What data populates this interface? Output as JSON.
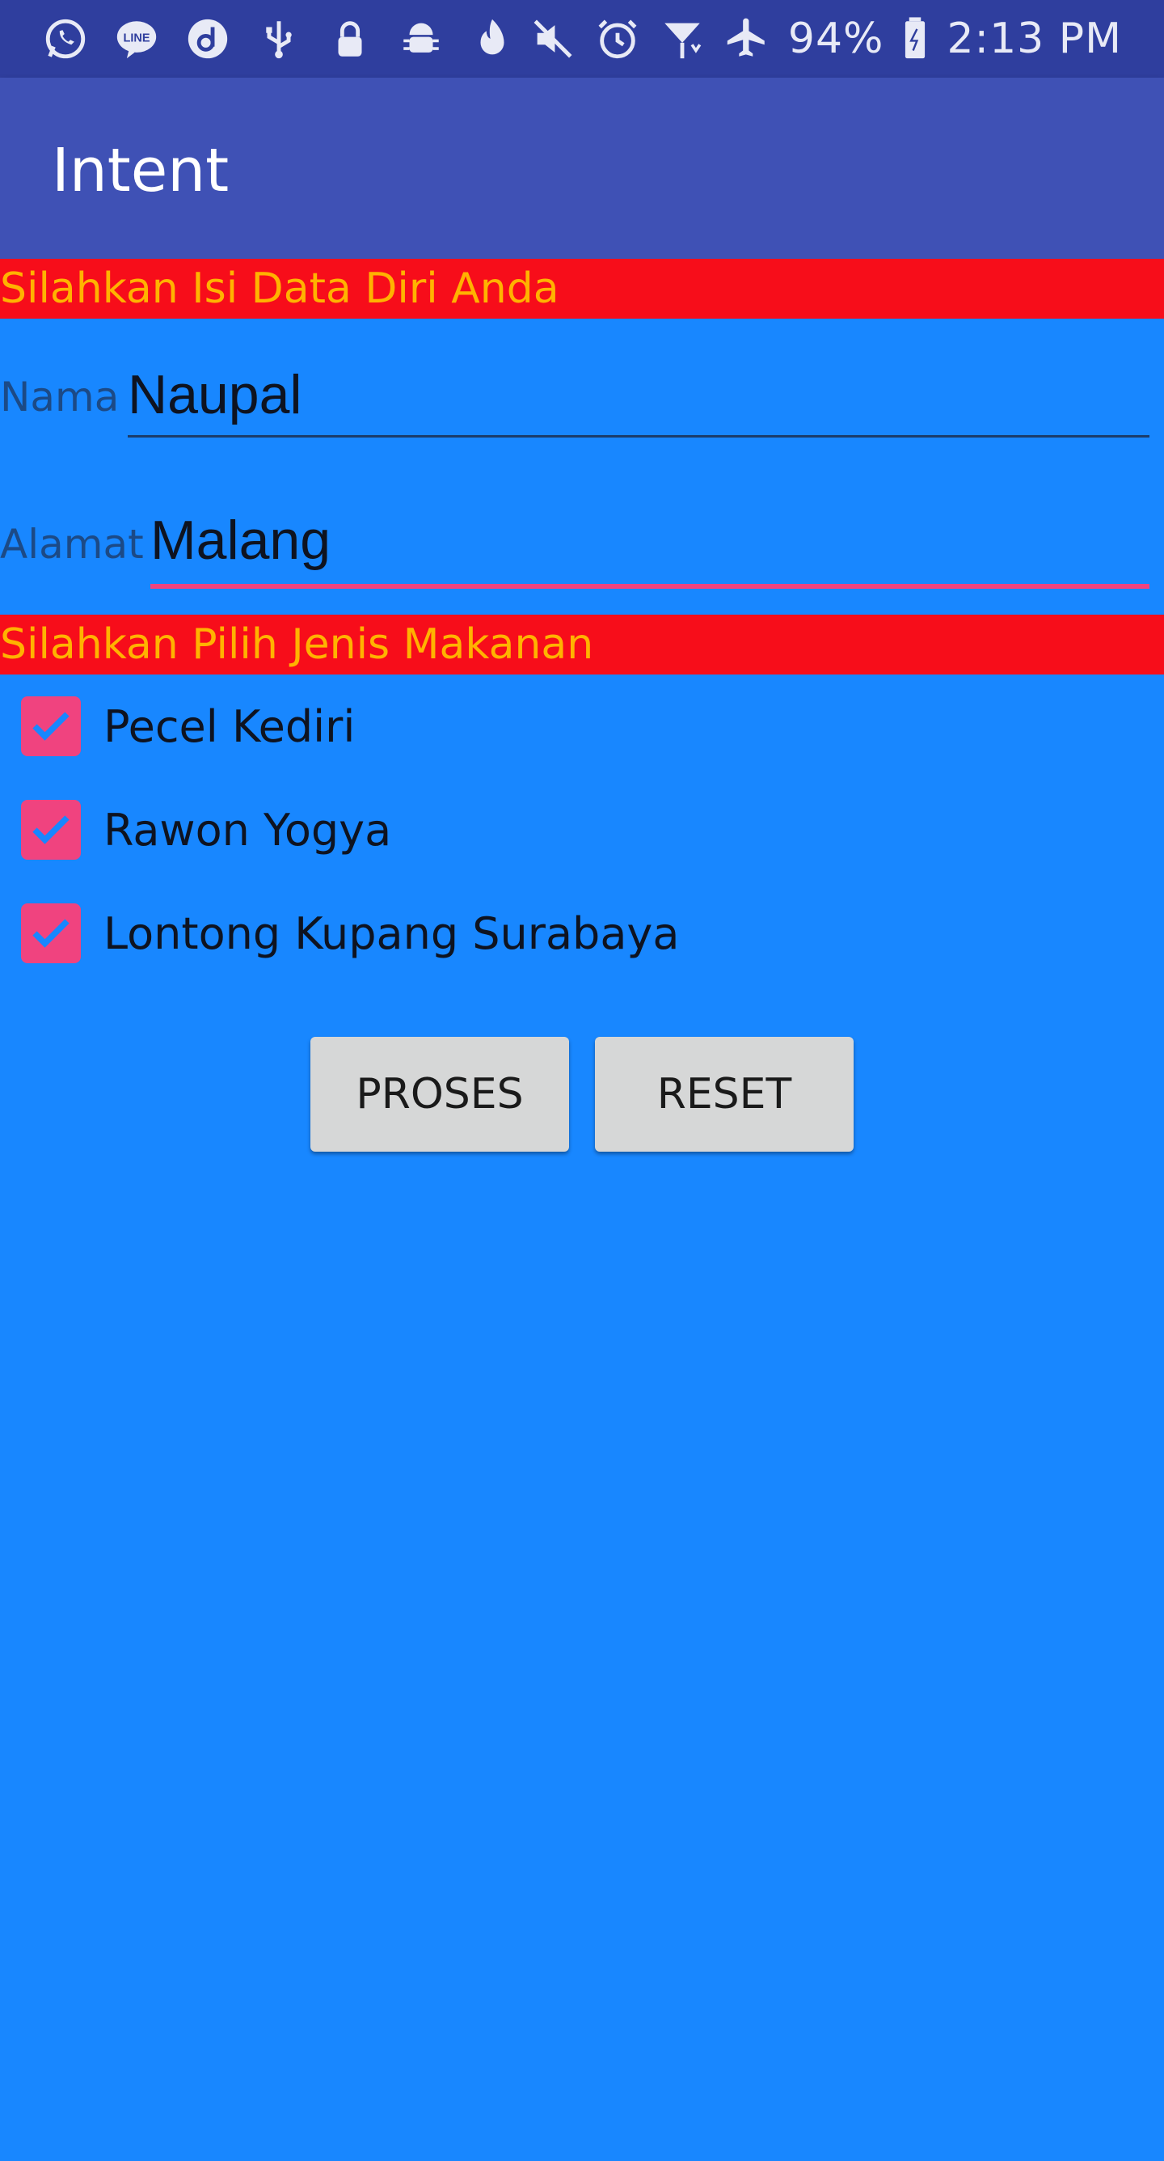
{
  "status_bar": {
    "left_icons": [
      "whatsapp-icon",
      "line-icon",
      "dana-icon",
      "usb-icon",
      "lock-icon",
      "android-debug-icon",
      "tinder-icon"
    ],
    "right_icons": [
      "mute-icon",
      "alarm-icon",
      "signal-icon",
      "airplane-icon",
      "battery-icon"
    ],
    "battery": "94%",
    "time": "2:13 PM"
  },
  "app_bar": {
    "title": "Intent"
  },
  "personal_section": {
    "header": "Silahkan Isi Data Diri Anda"
  },
  "form": {
    "nama": {
      "label": "Nama",
      "value": "Naupal"
    },
    "alamat": {
      "label": "Alamat",
      "value": "Malang"
    }
  },
  "food_section": {
    "header": "Silahkan Pilih Jenis Makanan"
  },
  "foods": [
    {
      "label": "Pecel Kediri",
      "checked": true
    },
    {
      "label": "Rawon Yogya",
      "checked": true
    },
    {
      "label": "Lontong Kupang Surabaya",
      "checked": true
    }
  ],
  "buttons": {
    "proses": "PROSES",
    "reset": "RESET"
  },
  "colors": {
    "status_bar": "#2F3E9E",
    "app_bar": "#3F51B5",
    "background": "#1887FF",
    "section_header_bg": "#F70D1A",
    "section_header_text": "#FFB300",
    "accent": "#F0437F",
    "button": "#D6D7D7"
  }
}
